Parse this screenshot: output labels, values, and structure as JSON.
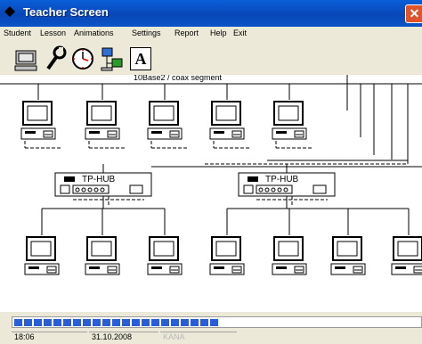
{
  "window": {
    "title": "Teacher Screen",
    "close_glyph": "✕"
  },
  "menu": [
    "Student",
    "Lesson",
    "Animations",
    "Settings",
    "Report",
    "Help",
    "Exit"
  ],
  "toolbar": [
    {
      "name": "computer-icon"
    },
    {
      "name": "wrench-icon"
    },
    {
      "name": "clock-icon"
    },
    {
      "name": "network-computers-icon"
    },
    {
      "name": "text-tool-icon",
      "glyph": "A"
    }
  ],
  "canvas": {
    "segment_label": "10Base2 / coax segment",
    "hubs": [
      {
        "label": "TP-HUB"
      },
      {
        "label": "TP-HUB"
      }
    ]
  },
  "progress": {
    "filled_segments": 21,
    "color": "#2a5ed6"
  },
  "status": {
    "time": "18:06",
    "date": "31.10.2008",
    "mode": "KANA"
  }
}
